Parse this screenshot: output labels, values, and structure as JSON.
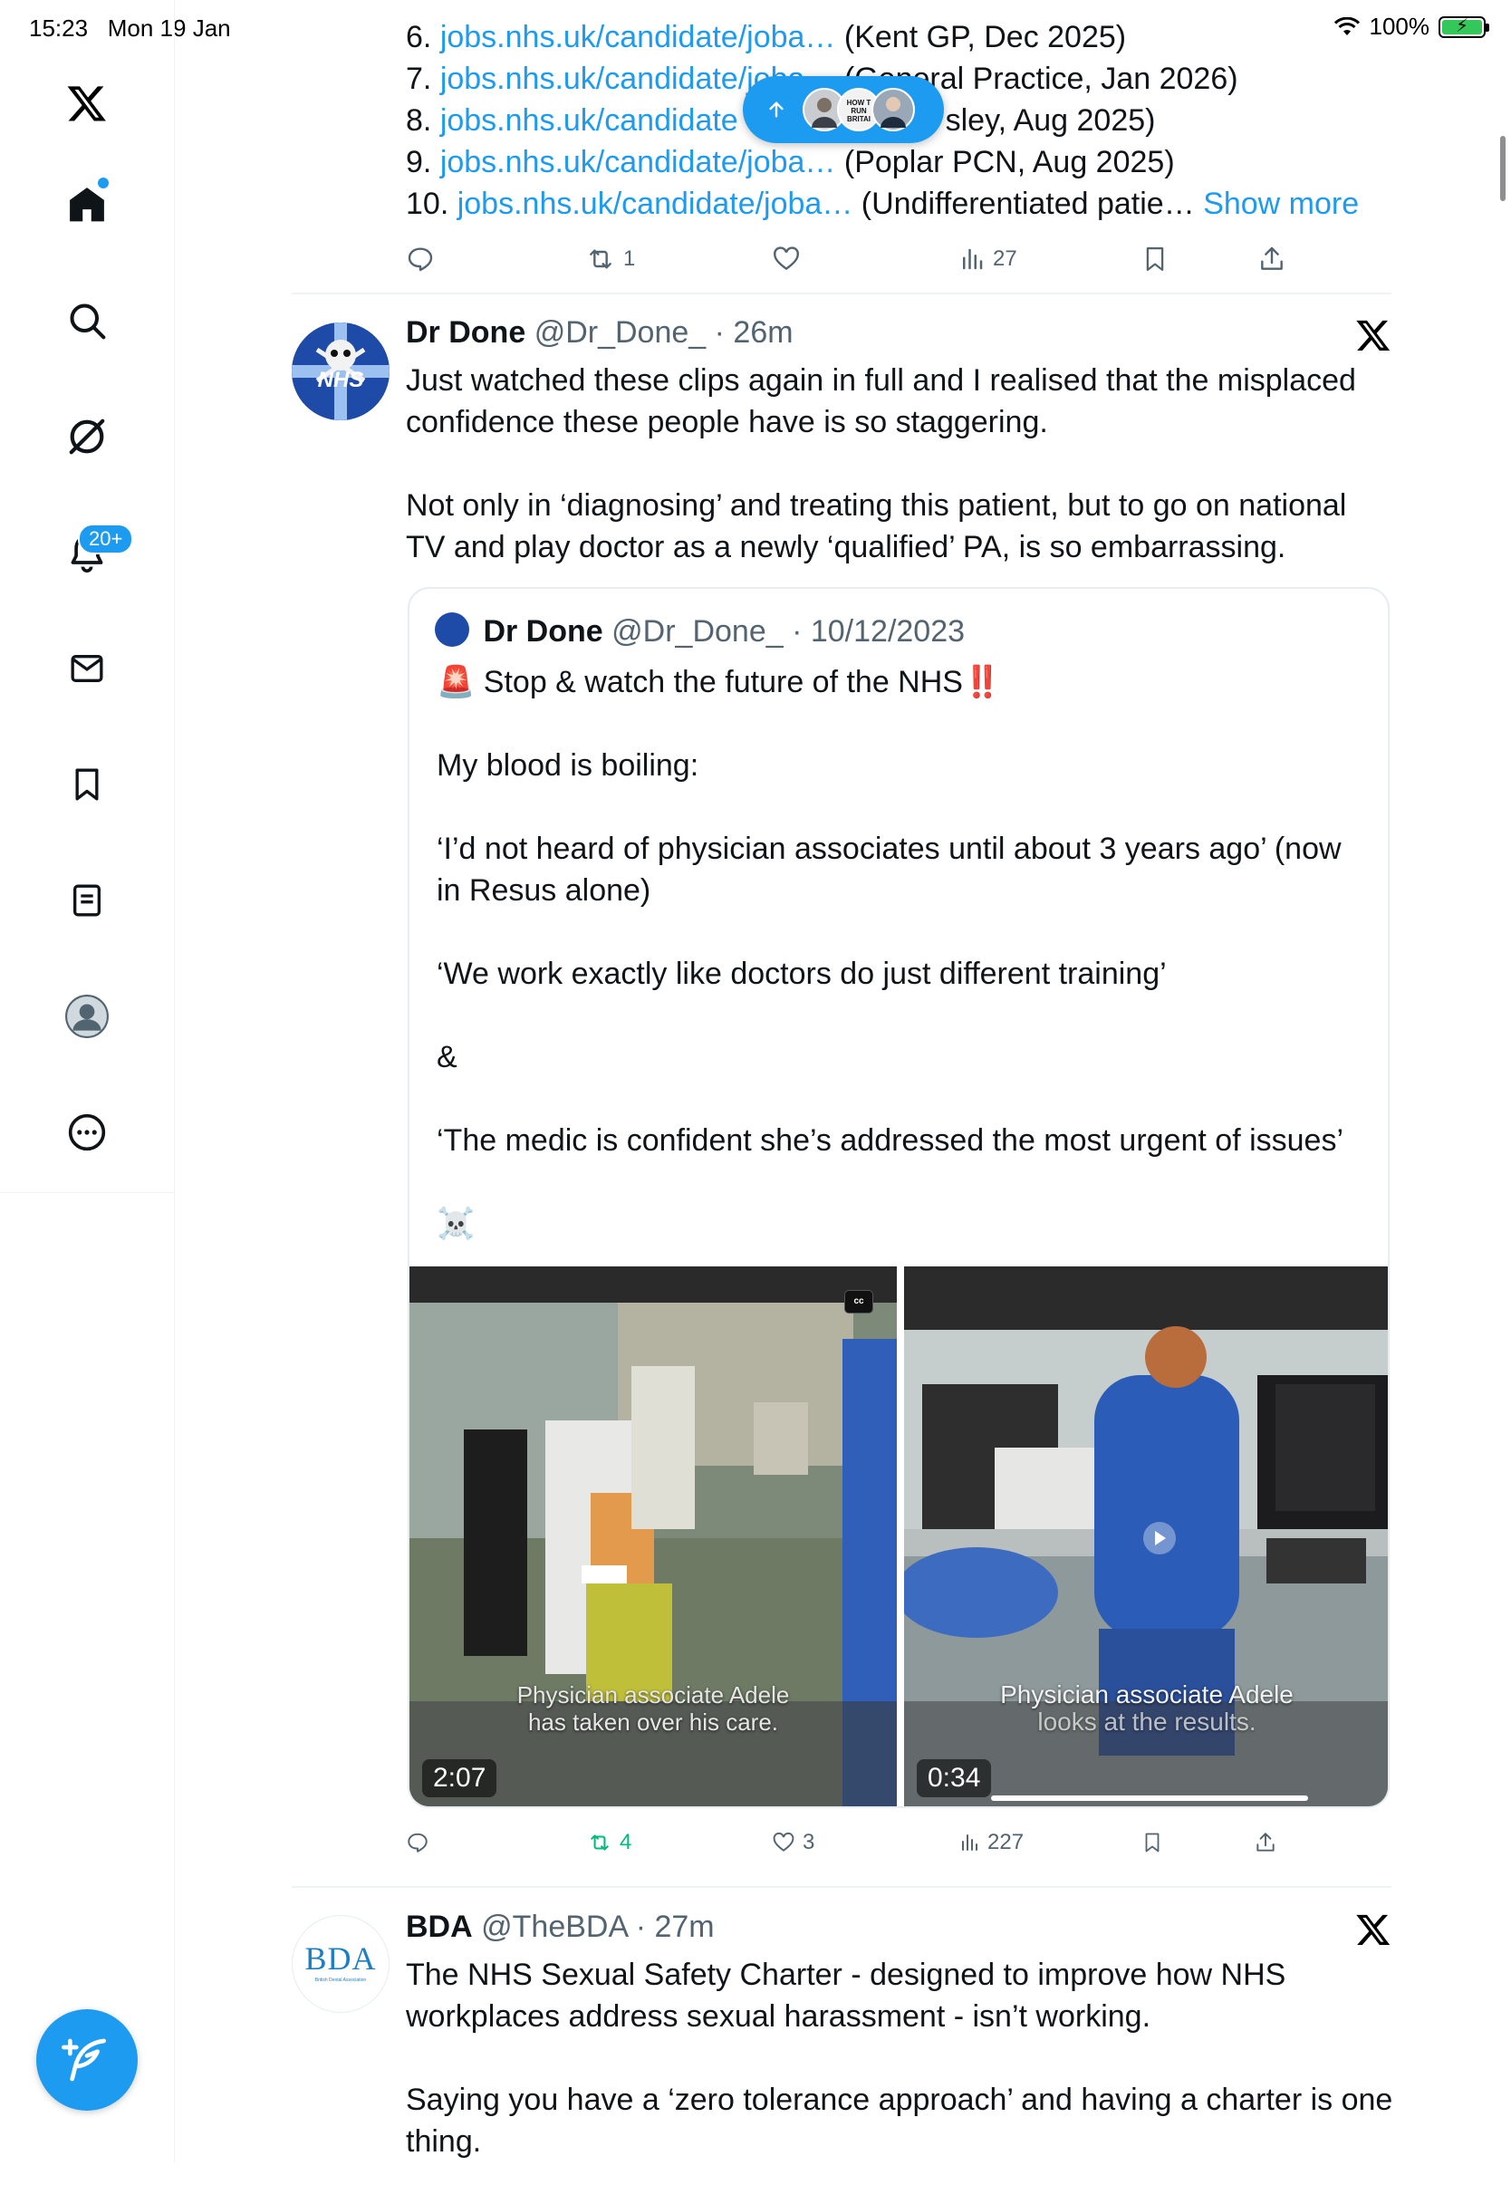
{
  "status": {
    "time": "15:23",
    "date": "Mon 19 Jan",
    "battery": "100%"
  },
  "sidebar": {
    "notifications_badge": "20+"
  },
  "prev_tweet": {
    "rows": [
      {
        "num": "6.",
        "link": "jobs.nhs.uk/candidate/joba…",
        "desc": "(Kent GP, Dec 2025)"
      },
      {
        "num": "7.",
        "link": "jobs.nhs.uk/candidate/joba…",
        "desc": "(General Practice, Jan 2026)"
      },
      {
        "num": "8.",
        "link": "jobs.nhs.uk/candidate",
        "desc": "sley, Aug 2025)"
      },
      {
        "num": "9.",
        "link": "jobs.nhs.uk/candidate/joba…",
        "desc": "(Poplar PCN, Aug 2025)"
      },
      {
        "num": "10.",
        "link": "jobs.nhs.uk/candidate/joba…",
        "desc": "(Undifferentiated patie…"
      }
    ],
    "show_more": "Show more",
    "retweets": "1",
    "views": "27"
  },
  "scroll_pill": {
    "mini_label": "HOW T RUN BRITAI"
  },
  "tweet1": {
    "name": "Dr Done",
    "handle": "@Dr_Done_",
    "time": "26m",
    "avatar_text": "NHS",
    "body": [
      "Just watched these clips again in full and I realised that the misplaced confidence these people have is so staggering.",
      "Not only in ‘diagnosing’ and treating this patient, but to go on national TV and play doctor as a newly ‘qualified’ PA, is so embarrassing."
    ],
    "quote": {
      "name": "Dr Done",
      "handle": "@Dr_Done_",
      "date": "10/12/2023",
      "line1": "Stop & watch the future of the NHS",
      "siren": "🚨",
      "bangs": "‼️",
      "paras": [
        "My blood is boiling:",
        "‘I’d not heard of physician associates until about 3 years ago’ (now in Resus alone)",
        "‘We work exactly like doctors do just different training’",
        "&",
        "‘The medic is confident she’s addressed the most urgent of issues’",
        "☠️"
      ],
      "videos": [
        {
          "duration": "2:07",
          "caption_1": "Physician associate Adele",
          "caption_2": "has taken over his care.",
          "cc": "cc"
        },
        {
          "duration": "0:34",
          "caption_1": "Physician associate Adele",
          "caption_2": "looks at the results."
        }
      ]
    },
    "retweets": "4",
    "likes": "3",
    "views": "227"
  },
  "tweet2": {
    "name": "BDA",
    "handle": "@TheBDA",
    "time": "27m",
    "avatar_text": "BDA",
    "avatar_subtext": "British Dental Association",
    "body": [
      "The NHS Sexual Safety Charter - designed to improve how NHS workplaces address sexual harassment - isn’t working.",
      "Saying you have a ‘zero tolerance approach’ and having a charter is one thing."
    ]
  },
  "colors": {
    "accent": "#1d9bf0",
    "retweet_active": "#00ba7c",
    "muted": "#536471"
  }
}
